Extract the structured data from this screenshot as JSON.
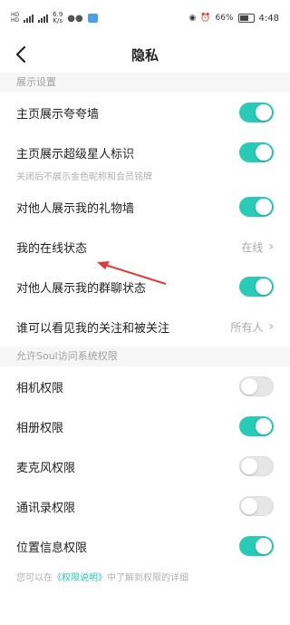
{
  "status_bar": {
    "left_badges": [
      "HD",
      "HD"
    ],
    "net_speed": "6.9",
    "net_unit": "K/s",
    "battery": "66%",
    "time": "4:48"
  },
  "nav": {
    "title": "隐私"
  },
  "sections": [
    {
      "header": "展示设置",
      "rows": [
        {
          "label": "主页展示夸夸墙",
          "type": "toggle",
          "on": true
        },
        {
          "label": "主页展示超级星人标识",
          "type": "toggle",
          "on": true,
          "note": "关闭后不展示金色昵称和会员铭牌"
        },
        {
          "label": "对他人展示我的礼物墙",
          "type": "toggle",
          "on": true
        },
        {
          "label": "我的在线状态",
          "type": "link",
          "value": "在线"
        },
        {
          "label": "对他人展示我的群聊状态",
          "type": "toggle",
          "on": true
        },
        {
          "label": "谁可以看见我的关注和被关注",
          "type": "link",
          "value": "所有人"
        }
      ]
    },
    {
      "header": "允许Soul访问系统权限",
      "rows": [
        {
          "label": "相机权限",
          "type": "toggle",
          "on": false
        },
        {
          "label": "相册权限",
          "type": "toggle",
          "on": true
        },
        {
          "label": "麦克风权限",
          "type": "toggle",
          "on": false
        },
        {
          "label": "通讯录权限",
          "type": "toggle",
          "on": false
        },
        {
          "label": "位置信息权限",
          "type": "toggle",
          "on": true
        }
      ]
    }
  ],
  "footer": {
    "prefix": "您可以在",
    "link": "《权限说明》",
    "suffix": "中了解到权限的详细"
  },
  "colors": {
    "accent": "#27cbb6",
    "annotation": "#e03a3a"
  }
}
